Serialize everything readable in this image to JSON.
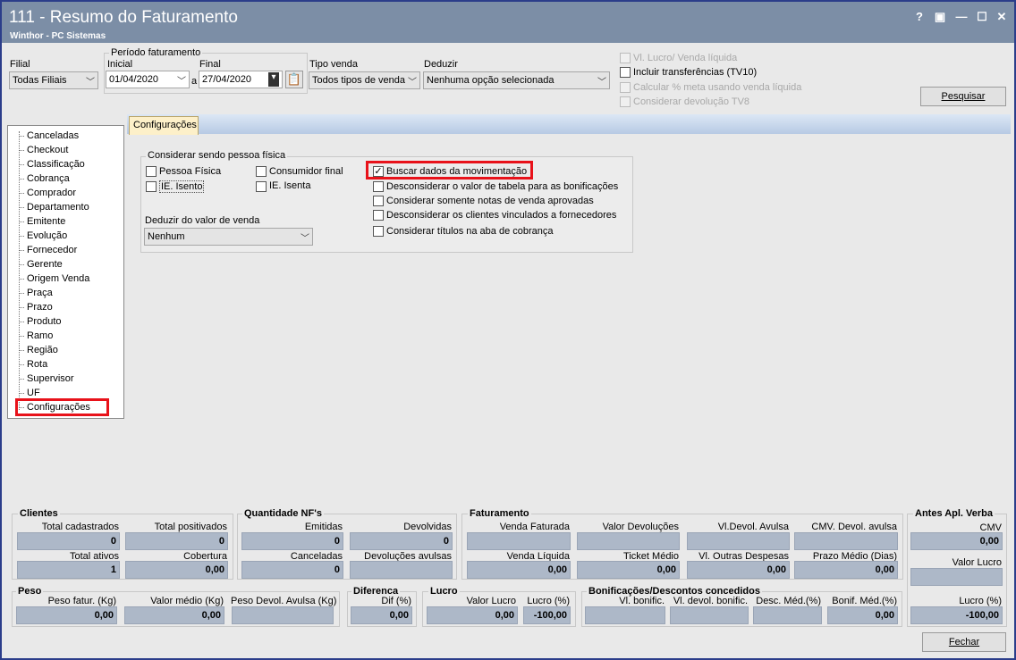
{
  "window": {
    "title": "111 - Resumo do Faturamento",
    "subtitle": "Winthor - PC Sistemas",
    "help": "?",
    "restore": "▣",
    "minimize": "—",
    "maximize": "☐",
    "close": "✕"
  },
  "filters": {
    "filial_label": "Filial",
    "filial_value": "Todas Filiais",
    "periodo_label": "Período faturamento",
    "inicial_label": "Inicial",
    "inicial_value": "01/04/2020",
    "a_label": "a",
    "final_label": "Final",
    "final_value": "27/04/2020",
    "tipo_venda_label": "Tipo venda",
    "tipo_venda_value": "Todos tipos de venda",
    "deduzir_label": "Deduzir",
    "deduzir_value": "Nenhuma opção selecionada"
  },
  "top_options": [
    {
      "label": "Vl. Lucro/ Venda líquida",
      "enabled": false,
      "checked": false
    },
    {
      "label": "Incluir transferências  (TV10)",
      "enabled": true,
      "checked": false
    },
    {
      "label": "Calcular % meta usando venda líquida",
      "enabled": false,
      "checked": false
    },
    {
      "label": "Considerar devolução TV8",
      "enabled": false,
      "checked": false
    }
  ],
  "pesquisar_label": "Pesquisar",
  "tree": [
    "Canceladas",
    "Checkout",
    "Classificação",
    "Cobrança",
    "Comprador",
    "Departamento",
    "Emitente",
    "Evolução",
    "Fornecedor",
    "Gerente",
    "Origem Venda",
    "Praça",
    "Prazo",
    "Produto",
    "Ramo",
    "Região",
    "Rota",
    "Supervisor",
    "UF",
    "Configurações"
  ],
  "tab_label": "Configurações",
  "config": {
    "pessoa_fisica_title": "Considerar sendo pessoa física",
    "pf_options": [
      "Pessoa Física",
      "Consumidor final",
      "IE. Isento",
      "IE. Isenta"
    ],
    "deduzir_valor_label": "Deduzir do valor de venda",
    "deduzir_valor_value": "Nenhum",
    "options": [
      {
        "label": "Buscar dados da movimentação",
        "checked": true
      },
      {
        "label": "Desconsiderar o valor de tabela para as bonificações",
        "checked": false
      },
      {
        "label": "Considerar somente notas de venda aprovadas",
        "checked": false
      },
      {
        "label": "Desconsiderar os clientes vinculados a fornecedores",
        "checked": false
      },
      {
        "label": "Considerar títulos na aba de cobrança",
        "checked": false
      }
    ]
  },
  "clientes": {
    "title": "Clientes",
    "total_cadastrados": "Total cadastrados",
    "total_cadastrados_v": "0",
    "total_positivados": "Total positivados",
    "total_positivados_v": "0",
    "total_ativos": "Total ativos",
    "total_ativos_v": "1",
    "cobertura": "Cobertura",
    "cobertura_v": "0,00"
  },
  "nf": {
    "title": "Quantidade NF's",
    "emitidas": "Emitidas",
    "emitidas_v": "0",
    "devolvidas": "Devolvidas",
    "devolvidas_v": "0",
    "canceladas": "Canceladas",
    "canceladas_v": "0",
    "devolucoes_avulsas": "Devoluções avulsas",
    "devolucoes_avulsas_v": ""
  },
  "faturamento": {
    "title": "Faturamento",
    "venda_faturada": "Venda Faturada",
    "venda_faturada_v": "",
    "valor_devolucoes": "Valor Devoluções",
    "valor_devolucoes_v": "",
    "vl_devol_avulsa": "Vl.Devol. Avulsa",
    "vl_devol_avulsa_v": "",
    "cmv_devol_avulsa": "CMV. Devol. avulsa",
    "cmv_devol_avulsa_v": "",
    "venda_liquida": "Venda Líquida",
    "venda_liquida_v": "0,00",
    "ticket_medio": "Ticket Médio",
    "ticket_medio_v": "0,00",
    "vl_outras_despesas": "Vl. Outras Despesas",
    "vl_outras_despesas_v": "0,00",
    "prazo_medio": "Prazo Médio (Dias)",
    "prazo_medio_v": "0,00"
  },
  "antes": {
    "title": "Antes Apl. Verba",
    "cmv": "CMV",
    "cmv_v": "0,00",
    "valor_lucro": "Valor Lucro",
    "valor_lucro_v": "",
    "lucro_pct": "Lucro (%)",
    "lucro_pct_v": "-100,00"
  },
  "peso": {
    "title": "Peso",
    "peso_fatur": "Peso fatur. (Kg)",
    "peso_fatur_v": "0,00",
    "valor_medio": "Valor médio (Kg)",
    "valor_medio_v": "0,00",
    "peso_devol": "Peso Devol. Avulsa (Kg)",
    "peso_devol_v": ""
  },
  "diferenca": {
    "title": "Diferenca",
    "dif": "Dif (%)",
    "dif_v": "0,00"
  },
  "lucro": {
    "title": "Lucro",
    "valor_lucro": "Valor Lucro",
    "valor_lucro_v": "0,00",
    "lucro_pct": "Lucro (%)",
    "lucro_pct_v": "-100,00"
  },
  "bonif": {
    "title": "Bonificações/Descontos concedidos",
    "vl_bonific": "Vl. bonific.",
    "vl_bonific_v": "",
    "vl_devol_bonific": "Vl. devol. bonific.",
    "vl_devol_bonific_v": "",
    "desc_med": "Desc. Méd.(%)",
    "desc_med_v": "",
    "bonif_med": "Bonif. Méd.(%)",
    "bonif_med_v": "0,00"
  },
  "fechar_label": "Fechar"
}
